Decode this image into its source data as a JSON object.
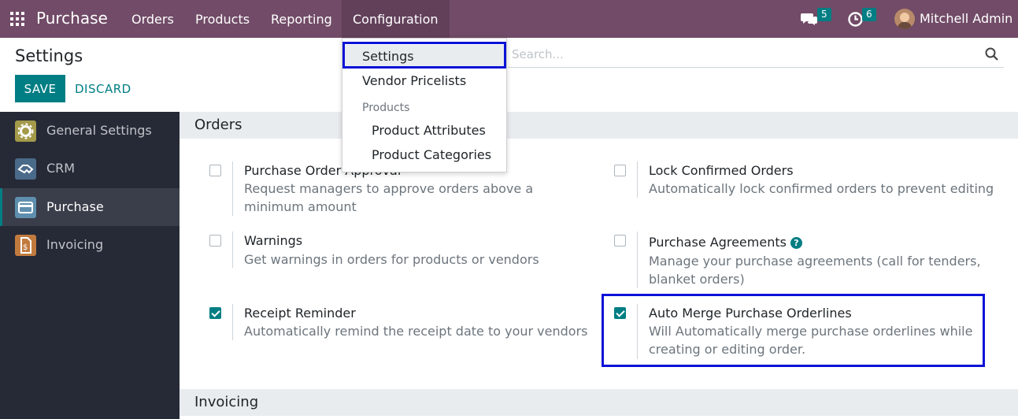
{
  "navbar": {
    "brand": "Purchase",
    "menus": [
      "Orders",
      "Products",
      "Reporting",
      "Configuration"
    ],
    "messages_count": "5",
    "activities_count": "6",
    "user_name": "Mitchell Admin"
  },
  "control_panel": {
    "title": "Settings",
    "save_label": "SAVE",
    "discard_label": "DISCARD",
    "search_placeholder": "Search..."
  },
  "config_menu": {
    "items": [
      "Settings",
      "Vendor Pricelists"
    ],
    "group_header": "Products",
    "group_items": [
      "Product Attributes",
      "Product Categories"
    ]
  },
  "sidebar": {
    "items": [
      {
        "label": "General Settings",
        "icon": "gear-icon",
        "color": "#a39a4a"
      },
      {
        "label": "CRM",
        "icon": "handshake-icon",
        "color": "#4a6a8a"
      },
      {
        "label": "Purchase",
        "icon": "credit-card-icon",
        "color": "#5f8fae"
      },
      {
        "label": "Invoicing",
        "icon": "invoice-icon",
        "color": "#c27b3f"
      }
    ]
  },
  "sections": {
    "orders": "Orders",
    "invoicing": "Invoicing"
  },
  "settings": {
    "po_approval": {
      "title": "Purchase Order Approval",
      "desc": "Request managers to approve orders above a minimum amount",
      "checked": false
    },
    "lock_orders": {
      "title": "Lock Confirmed Orders",
      "desc": "Automatically lock confirmed orders to prevent editing",
      "checked": false
    },
    "warnings": {
      "title": "Warnings",
      "desc": "Get warnings in orders for products or vendors",
      "checked": false
    },
    "agreements": {
      "title": "Purchase Agreements",
      "desc": "Manage your purchase agreements (call for tenders, blanket orders)",
      "checked": false
    },
    "receipt_reminder": {
      "title": "Receipt Reminder",
      "desc": "Automatically remind the receipt date to your vendors",
      "checked": true
    },
    "auto_merge": {
      "title": "Auto Merge Purchase Orderlines",
      "desc": "Will Automatically merge purchase orderlines while creating or editing order.",
      "checked": true
    }
  },
  "colors": {
    "navbar": "#714b67",
    "accent": "#017e84",
    "highlight": "#0b12d6"
  }
}
